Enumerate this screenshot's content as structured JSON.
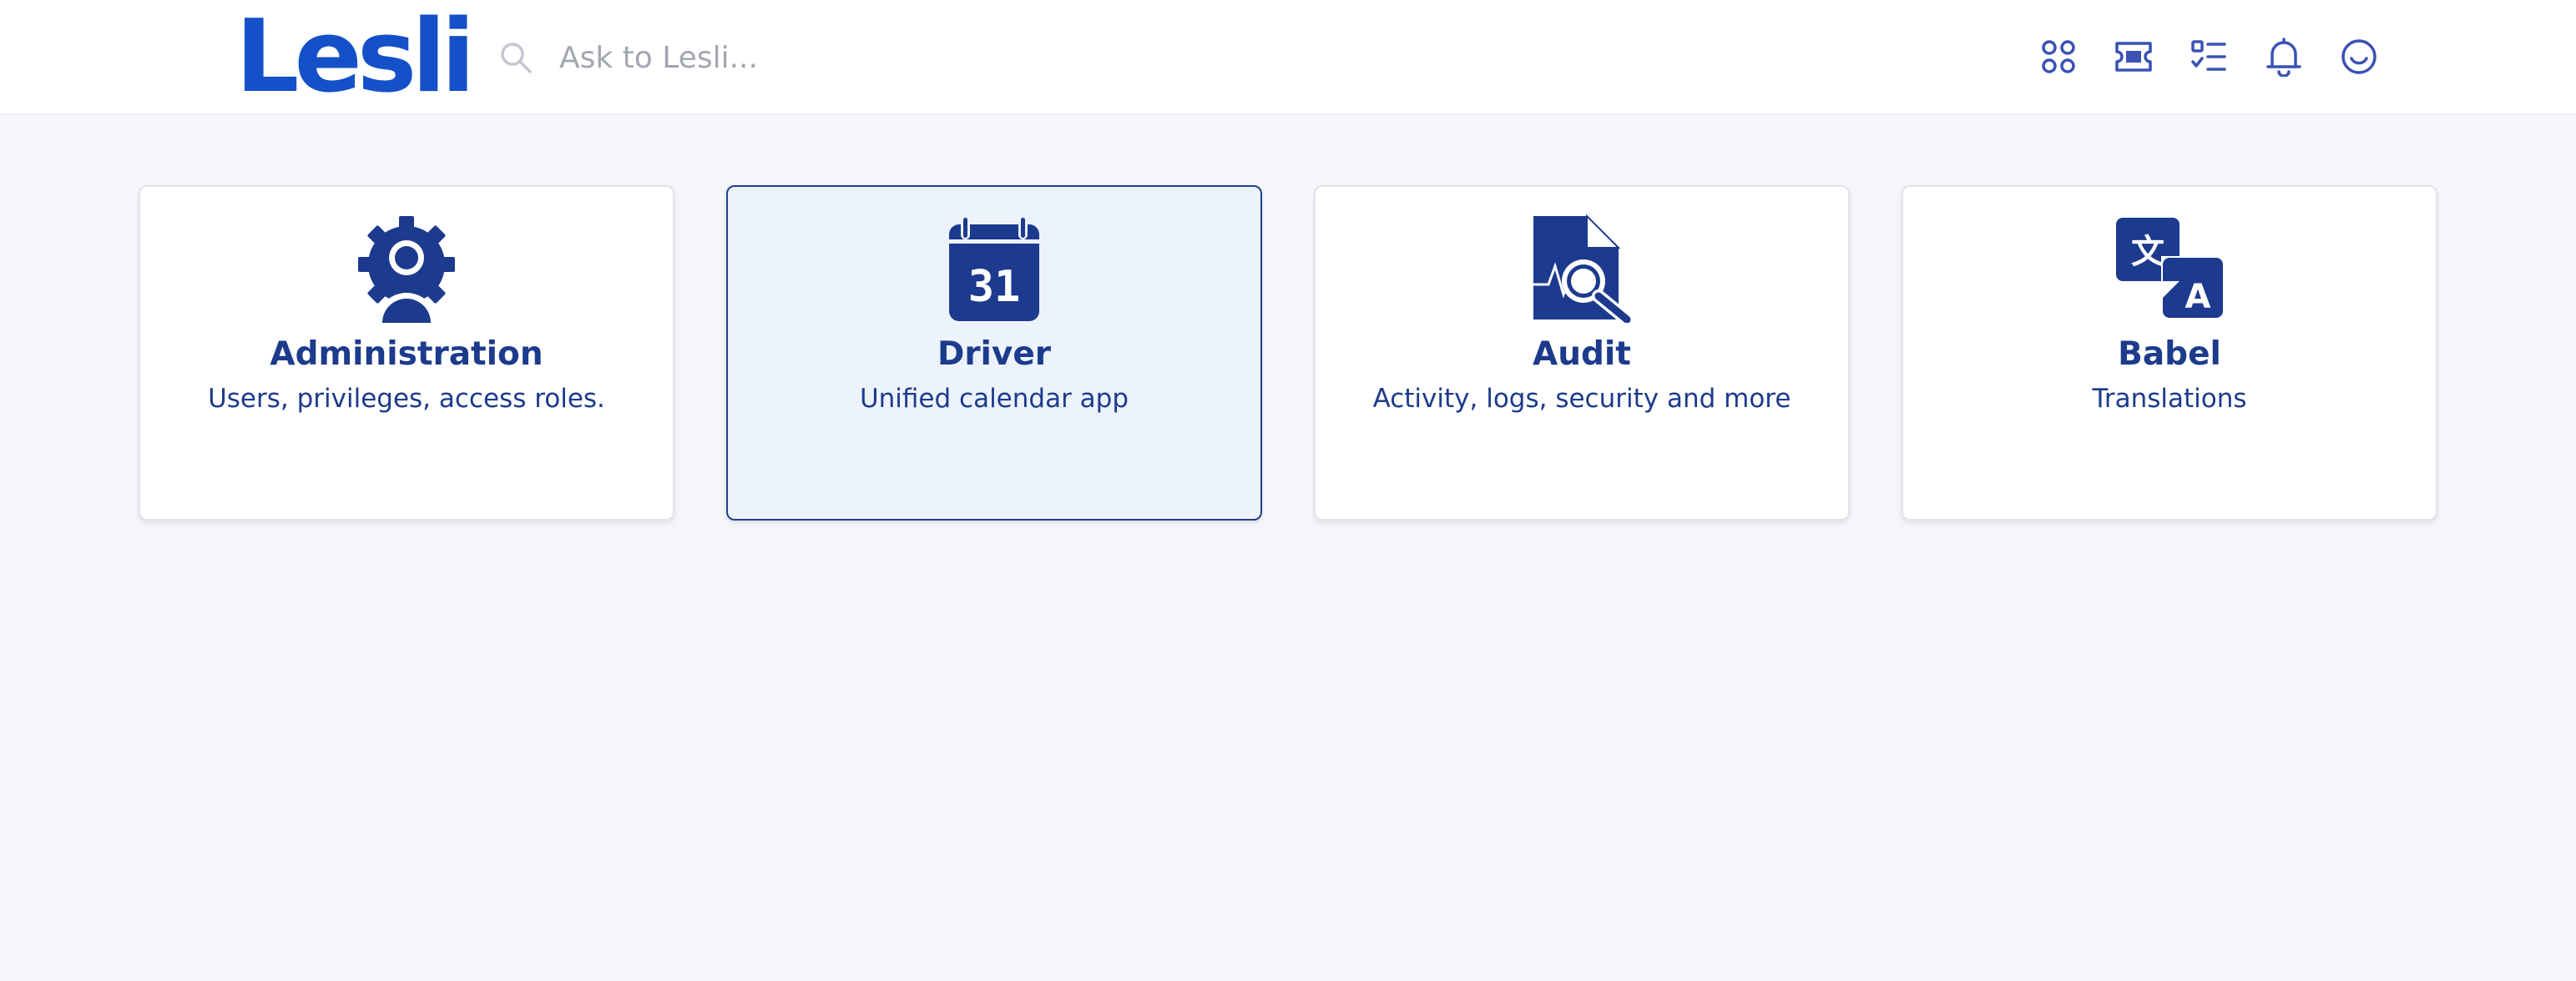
{
  "header": {
    "logo": "Lesli",
    "search_placeholder": "Ask to Lesli...",
    "icons": [
      "apps-icon",
      "ticket-icon",
      "tasks-icon",
      "bell-icon",
      "smiley-icon"
    ]
  },
  "colors": {
    "brand": "#1450c8",
    "card_text": "#1c3b8c",
    "icon_fill": "#1c3a8e",
    "active_card_bg": "#edf3fd",
    "active_card_border": "#233f8a",
    "page_bg": "#f5f6fa"
  },
  "cards": [
    {
      "title": "Administration",
      "description": "Users, privileges, access roles.",
      "icon": "user-gear-icon",
      "active": false
    },
    {
      "title": "Driver",
      "description": "Unified calendar app",
      "icon": "calendar-icon",
      "active": true,
      "icon_text": "31"
    },
    {
      "title": "Audit",
      "description": "Activity, logs, security and more",
      "icon": "document-search-icon",
      "active": false
    },
    {
      "title": "Babel",
      "description": "Translations",
      "icon": "translate-icon",
      "active": false,
      "icon_text_a": "文",
      "icon_text_b": "A"
    }
  ]
}
